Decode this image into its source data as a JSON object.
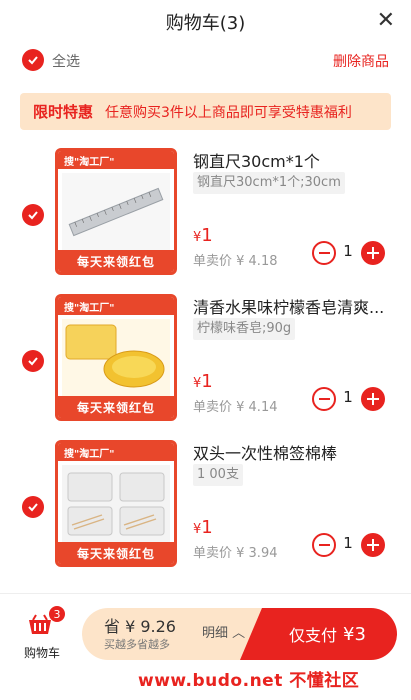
{
  "header": {
    "title": "购物车(3)",
    "close_icon": "close-icon"
  },
  "selectbar": {
    "select_all_label": "全选",
    "delete_label": "删除商品"
  },
  "promo": {
    "tag": "限时特惠",
    "message": "任意购买3件以上商品即可享受特惠福利"
  },
  "items": [
    {
      "name": "钢直尺30cm*1个",
      "spec": "钢直尺30cm*1个;30cm",
      "price_symbol": "¥",
      "price": "1",
      "unit_price": "单卖价 ¥ 4.18",
      "quantity": "1",
      "badge_brand": "搜\"淘工厂\"",
      "badge_text": "每天来领红包"
    },
    {
      "name": "清香水果味柠檬香皂清爽...",
      "spec": "柠檬味香皂;90g",
      "price_symbol": "¥",
      "price": "1",
      "unit_price": "单卖价 ¥ 4.14",
      "quantity": "1",
      "badge_brand": "搜\"淘工厂\"",
      "badge_text": "每天来领红包"
    },
    {
      "name": "双头一次性棉签棉棒",
      "spec": "1 00支",
      "price_symbol": "¥",
      "price": "1",
      "unit_price": "单卖价 ¥ 3.94",
      "quantity": "1",
      "badge_brand": "搜\"淘工厂\"",
      "badge_text": "每天来领红包"
    }
  ],
  "bottom": {
    "cart_label": "购物车",
    "cart_badge": "3",
    "save_text": "省 ¥ 9.26",
    "save_sub": "买越多省越多",
    "detail_label": "明细 ︿",
    "pay_label": "仅支付",
    "pay_amount": "¥3"
  },
  "watermark": "www.budo.net 不懂社区",
  "colors": {
    "accent": "#e8231f",
    "promo_bg": "#fde4c9",
    "thumb_border": "#e8472b"
  }
}
